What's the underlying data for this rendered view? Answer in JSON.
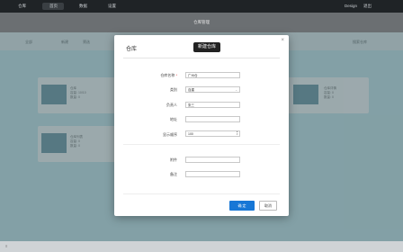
{
  "topnav": {
    "items": [
      "仓库",
      "首页",
      "数据",
      "设置"
    ],
    "right": [
      "Design",
      "退出"
    ]
  },
  "subbar": {
    "title": "仓库管理"
  },
  "toolbar": {
    "items": [
      "全部",
      "新建",
      "筛选"
    ],
    "search_placeholder": "搜索仓库"
  },
  "cards": [
    {
      "title": "仓库",
      "line1": "容量: 10/10",
      "line2": "数量: 0"
    },
    {
      "title": "仓库列表",
      "line1": "容量: 0",
      "line2": "数量: 0"
    },
    {
      "title": "仓库详情",
      "line1": "容量: 0",
      "line2": "数量: 0"
    }
  ],
  "modal": {
    "title": "仓库",
    "badge": "新建仓库",
    "fields": {
      "name": {
        "label": "仓库名称",
        "required_mark": "*",
        "value": "广州仓"
      },
      "type": {
        "label": "类别",
        "value": "自建"
      },
      "manager": {
        "label": "负责人",
        "value": "张三"
      },
      "address": {
        "label": "地址",
        "value": ""
      },
      "sort": {
        "label": "显示顺序",
        "value": "100"
      },
      "attach": {
        "label": "附件",
        "value": ""
      },
      "remark": {
        "label": "备注",
        "value": ""
      }
    },
    "ok_label": "确 定",
    "cancel_label": "取消"
  },
  "bottombar": {
    "left": "≡"
  }
}
